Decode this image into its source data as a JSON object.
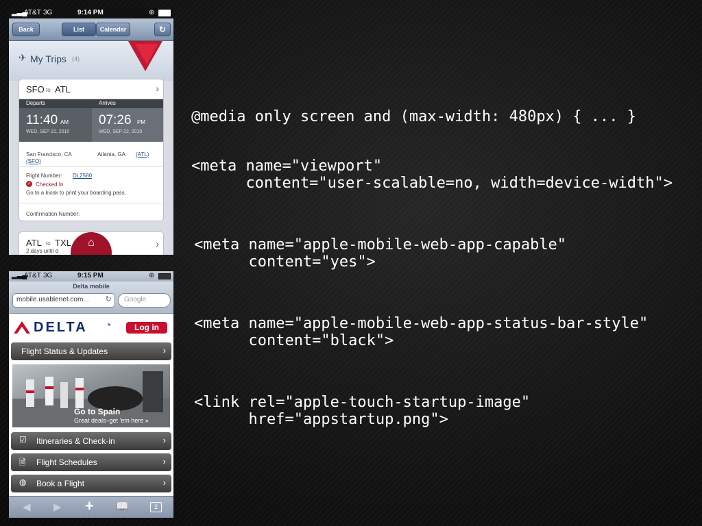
{
  "code_lines": {
    "l1": "@media only screen and (max-width: 480px) { ... }",
    "l2": "<meta name=\"viewport\"\n      content=\"user-scalable=no, width=device-width\">",
    "l3": "<meta name=\"apple-mobile-web-app-capable\"\n      content=\"yes\">",
    "l4": "<meta name=\"apple-mobile-web-app-status-bar-style\"\n      content=\"black\">",
    "l5": "<link rel=\"apple-touch-startup-image\"\n      href=\"appstartup.png\">"
  },
  "phone1": {
    "status": {
      "carrier": "AT&T",
      "network": "3G",
      "time": "9:14 PM"
    },
    "nav": {
      "back": "Back",
      "list": "List",
      "calendar": "Calendar"
    },
    "title": "My Trips",
    "count": "(4)",
    "trip1": {
      "route_from": "SFO",
      "route_to_word": "to",
      "route_to": "ATL",
      "departs_label": "Departs",
      "arrives_label": "Arrives",
      "depart_time": "11:40",
      "depart_ampm": "AM",
      "depart_date": "WED, SEP 22, 2010",
      "arrive_time": "07:26",
      "arrive_ampm": "PM",
      "arrive_date": "WED, SEP 22, 2010",
      "origin_city": "San Francisco, CA",
      "origin_code": "(SFO)",
      "dest_city": "Atlanta, GA",
      "dest_code": "(ATL)",
      "flight_label": "Flight Number:",
      "flight_number": "DL2580",
      "checked_in": "Checked In",
      "kiosk": "Go to a kiosk to print your boarding pass.",
      "confirmation": "Confirmation Number:"
    },
    "trip2": {
      "route_from": "ATL",
      "route_to_word": "to",
      "route_to": "TXL",
      "sub": "2 days until d"
    }
  },
  "phone2": {
    "status": {
      "carrier": "AT&T",
      "network": "3G",
      "time": "9:15 PM"
    },
    "page_title": "Delta mobile",
    "url": "mobile.usablenet.com...",
    "search_placeholder": "Google",
    "logo_text": "DELTA",
    "login": "Log in",
    "flight_status": "Flight Status & Updates",
    "promo_title": "Go to Spain",
    "promo_sub": "Great deals–get 'em here »",
    "itineraries": "Itineraries & Check-in",
    "schedules": "Flight Schedules",
    "book": "Book a Flight",
    "tabs_count": "2"
  }
}
